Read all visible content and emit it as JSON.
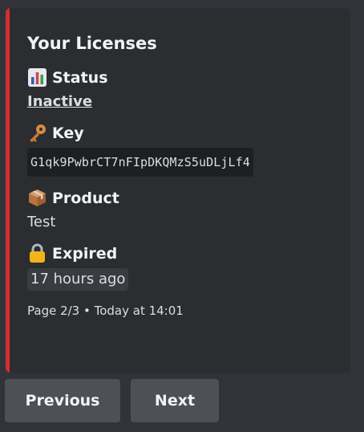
{
  "embed": {
    "accent_color": "#d32f2f",
    "title": "Your Licenses",
    "fields": [
      {
        "icon": "bar-chart-icon",
        "name": "Status",
        "value": "Inactive"
      },
      {
        "icon": "key-icon",
        "name": "Key",
        "value": "G1qk9PwbrCT7nFIpDKQMzS5uDLjLf4"
      },
      {
        "icon": "package-icon",
        "name": "Product",
        "value": "Test"
      },
      {
        "icon": "lock-icon",
        "name": "Expired",
        "value": "17 hours ago"
      }
    ],
    "footer": "Page 2/3 • Today at 14:01"
  },
  "buttons": {
    "previous": "Previous",
    "next": "Next"
  }
}
